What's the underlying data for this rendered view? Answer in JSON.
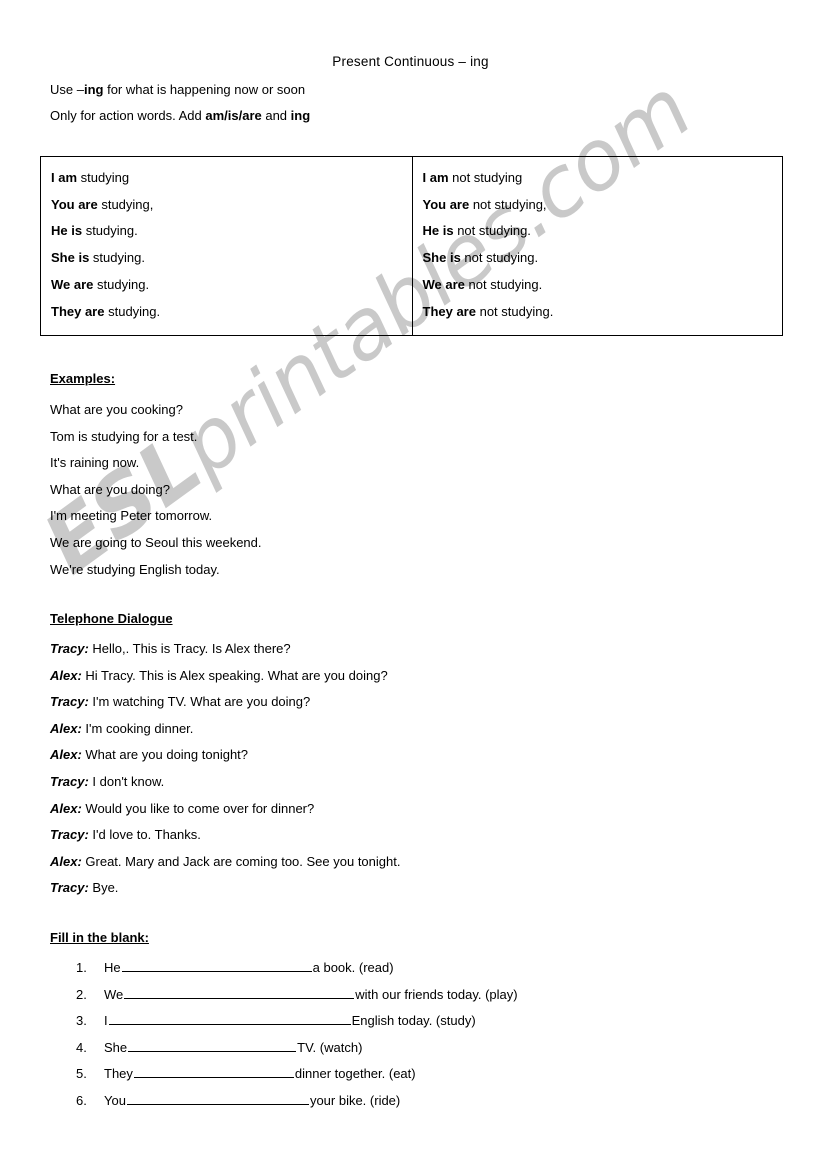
{
  "document": {
    "title": "Present Continuous  –  ing",
    "intro_line_1": {
      "pre": "Use –",
      "bold": "ing",
      "post": " for what is happening now or soon"
    },
    "intro_line_2": {
      "pre": "Only for action words.   Add ",
      "bold": "am/is/are",
      "post": " and ",
      "bold2": "ing"
    }
  },
  "watermark": {
    "bold_part": "ESL",
    "rest_part": "printables.com"
  },
  "conjugation_table": {
    "affirmative": [
      {
        "subject": "I",
        "aux": "am",
        "rest": " studying"
      },
      {
        "subject": "You",
        "aux": "are",
        "rest": " studying,"
      },
      {
        "subject": "He",
        "aux": "is",
        "rest": " studying."
      },
      {
        "subject": "She",
        "aux": "is",
        "rest": " studying."
      },
      {
        "subject": "We",
        "aux": "are",
        "rest": " studying."
      },
      {
        "subject": "They",
        "aux": "are",
        "rest": " studying."
      }
    ],
    "negative": [
      {
        "subject": "I",
        "aux": "am",
        "rest": " not studying"
      },
      {
        "subject": "You",
        "aux": "are",
        "rest": " not studying,"
      },
      {
        "subject": "He",
        "aux": "is",
        "rest": " not studying."
      },
      {
        "subject": "She",
        "aux": "is",
        "rest": " not studying."
      },
      {
        "subject": "We",
        "aux": "are",
        "rest": " not studying."
      },
      {
        "subject": "They",
        "aux": "are",
        "rest": " not studying."
      }
    ]
  },
  "examples": {
    "heading": "Examples:",
    "items": [
      "What are you cooking?",
      "Tom is studying for a test.",
      "It's raining now.",
      "What are you doing?",
      "I'm meeting Peter tomorrow.",
      "We are going to Seoul this weekend.",
      "We're studying English today."
    ]
  },
  "dialogue": {
    "heading": "Telephone Dialogue",
    "lines": [
      {
        "speaker": "Tracy:",
        "text": " Hello,. This is Tracy. Is Alex there?"
      },
      {
        "speaker": "Alex:",
        "text": " Hi Tracy. This is Alex speaking. What are you doing?"
      },
      {
        "speaker": "Tracy:",
        "text": " I'm watching TV. What are you doing?"
      },
      {
        "speaker": "Alex:",
        "text": " I'm cooking dinner."
      },
      {
        "speaker": "Alex:",
        "text": " What are you doing tonight?"
      },
      {
        "speaker": "Tracy:",
        "text": " I don't know."
      },
      {
        "speaker": "Alex:",
        "text": " Would you like to come over for dinner?"
      },
      {
        "speaker": "Tracy:",
        "text": " I'd love to. Thanks."
      },
      {
        "speaker": "Alex:",
        "text": " Great. Mary and Jack are coming too. See you tonight."
      },
      {
        "speaker": "Tracy:",
        "text": " Bye."
      }
    ]
  },
  "fill_in_the_blank": {
    "heading": "Fill in the blank:",
    "items": [
      {
        "number": "1.",
        "before": "He ",
        "blank_width": 190,
        "after": " a book. (read)"
      },
      {
        "number": "2.",
        "before": "We ",
        "blank_width": 230,
        "after": " with our friends today. (play)"
      },
      {
        "number": "3.",
        "before": "I",
        "blank_width": 242,
        "after": " English today. (study)"
      },
      {
        "number": "4.",
        "before": "She ",
        "blank_width": 168,
        "after": " TV. (watch)"
      },
      {
        "number": "5.",
        "before": "They ",
        "blank_width": 160,
        "after": " dinner together. (eat)"
      },
      {
        "number": "6.",
        "before": "You ",
        "blank_width": 182,
        "after": " your bike. (ride)"
      }
    ]
  }
}
